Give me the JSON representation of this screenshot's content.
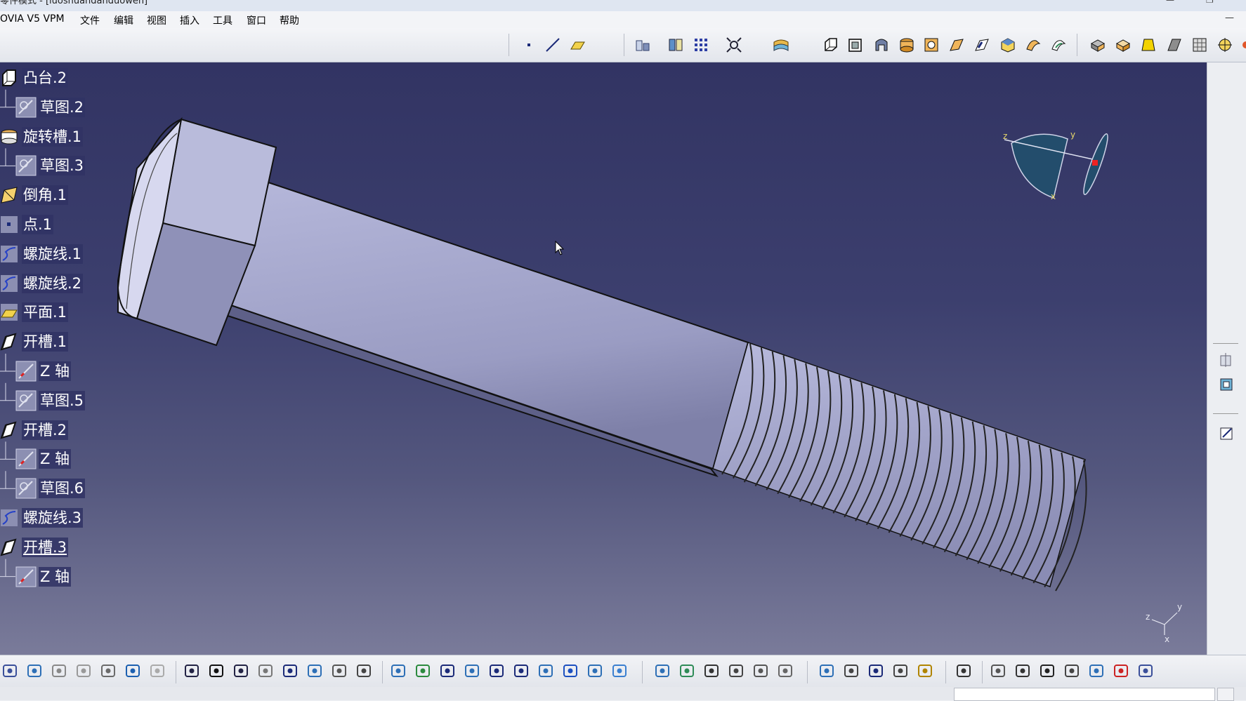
{
  "window": {
    "title": "零件模式 - [luoshuandanduowen]",
    "controls": {
      "minimize": "—",
      "restore": "❐"
    }
  },
  "menubar": {
    "app": "OVIA V5 VPM",
    "items": [
      "文件",
      "编辑",
      "视图",
      "插入",
      "工具",
      "窗口",
      "帮助"
    ]
  },
  "spec_tree": {
    "items": [
      {
        "label": "凸台.2",
        "icon": "pad-icon",
        "level": 0
      },
      {
        "label": "草图.2",
        "icon": "sketch-icon",
        "level": 1
      },
      {
        "label": "旋转槽.1",
        "icon": "groove-icon",
        "level": 0
      },
      {
        "label": "草图.3",
        "icon": "sketch-icon",
        "level": 1
      },
      {
        "label": "倒角.1",
        "icon": "chamfer-icon",
        "level": 0
      },
      {
        "label": "点.1",
        "icon": "point-icon",
        "level": 0
      },
      {
        "label": "螺旋线.1",
        "icon": "helix-icon",
        "level": 0
      },
      {
        "label": "螺旋线.2",
        "icon": "helix-icon",
        "level": 0
      },
      {
        "label": "平面.1",
        "icon": "plane-icon",
        "level": 0
      },
      {
        "label": "开槽.1",
        "icon": "slot-icon",
        "level": 0
      },
      {
        "label": "Z 轴",
        "icon": "axis-icon",
        "level": 1
      },
      {
        "label": "草图.5",
        "icon": "sketch-icon",
        "level": 1
      },
      {
        "label": "开槽.2",
        "icon": "slot-icon",
        "level": 0
      },
      {
        "label": "Z 轴",
        "icon": "axis-icon",
        "level": 1
      },
      {
        "label": "草图.6",
        "icon": "sketch-icon",
        "level": 1
      },
      {
        "label": "螺旋线.3",
        "icon": "helix-icon",
        "level": 0
      },
      {
        "label": "开槽.3",
        "icon": "slot-icon",
        "level": 0,
        "selected": true
      },
      {
        "label": "Z 轴",
        "icon": "axis-icon",
        "level": 1
      }
    ]
  },
  "compass": {
    "labels": {
      "x": "x",
      "y": "y",
      "z": "z"
    }
  },
  "axis_triad": {
    "labels": {
      "x": "x",
      "y": "y",
      "z": "z"
    }
  },
  "toolbar_top_icons": [
    "point-icon",
    "line-icon",
    "plane-icon",
    "measure-icon",
    "wireframe-icon",
    "grid-icon",
    "snap-icon",
    "surface-icon",
    "pad-icon",
    "pocket-icon",
    "shaft-icon",
    "groove-icon",
    "hole-icon",
    "rib-icon",
    "slot-icon",
    "stiffener-icon",
    "multi-section-icon",
    "removed-section-icon",
    "solid-icon",
    "thickness-icon",
    "draft-icon",
    "rectangular-pattern-icon",
    "axis-system-icon",
    "render-icon"
  ],
  "toolbar_bottom_icons": [
    "save-icon",
    "print-icon",
    "cut-icon",
    "copy-icon",
    "paste-icon",
    "undo-icon",
    "redo-icon",
    "whats-this-icon",
    "formula-icon",
    "comment-icon",
    "knowledge-icon",
    "table-icon",
    "graph-icon",
    "lock-icon",
    "list-icon",
    "fly-mode-icon",
    "fit-all-icon",
    "pan-icon",
    "rotate-icon",
    "zoom-in-icon",
    "zoom-out-icon",
    "normal-view-icon",
    "multi-view-icon",
    "iso-view-icon",
    "shading-icon",
    "hide-show-icon",
    "swap-space-icon",
    "apply-material-icon",
    "settings-icon",
    "analysis-icon",
    "catalog-icon",
    "param-icon",
    "capture-icon",
    "measure-between-icon",
    "measure-item-icon",
    "inertia-icon",
    "camera-icon",
    "refresh-icon",
    "hand-icon",
    "compass-icon",
    "decimal-icon",
    "view-mode-icon",
    "select-icon",
    "tree-expand-icon"
  ],
  "right_panel_icons": [
    "section-icon",
    "frame-icon",
    "sketcher-icon"
  ],
  "colors": {
    "viewport_top": "#323463",
    "viewport_bottom": "#7a7b9a",
    "part_fill": "#a6a8cc",
    "tree_label_bg": "#303264"
  }
}
